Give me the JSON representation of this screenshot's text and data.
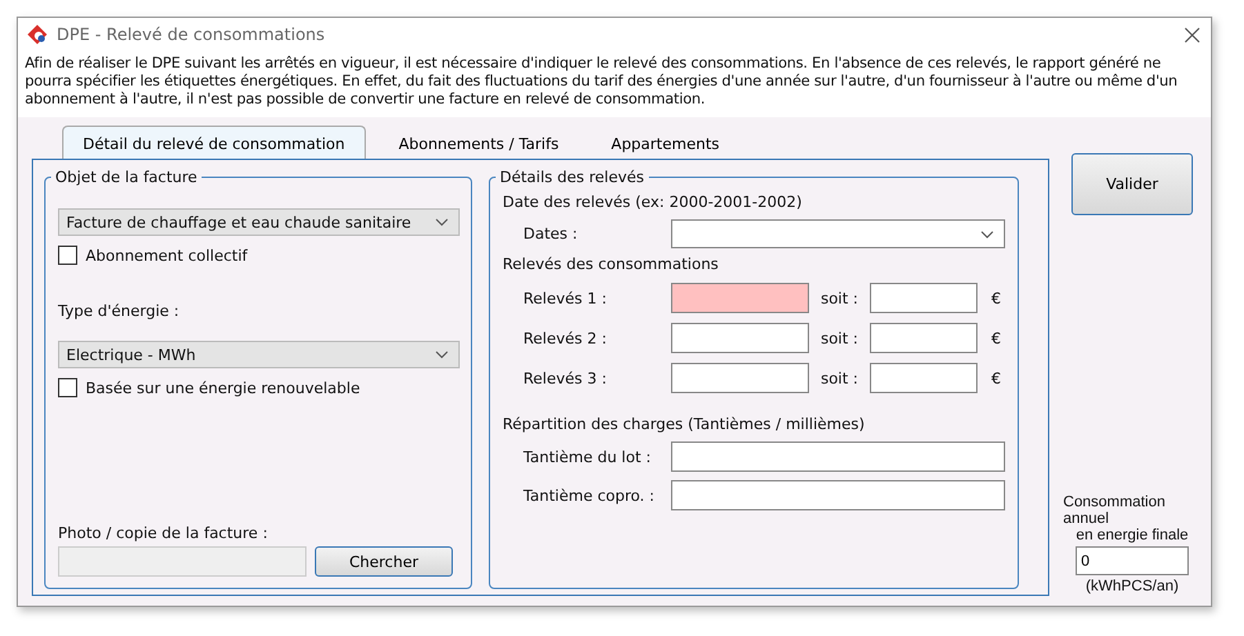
{
  "window": {
    "title": "DPE - Relevé de consommations"
  },
  "intro": "Afin de réaliser le DPE suivant les arrêtés en vigueur, il est nécessaire d'indiquer le relevé des consommations. En l'absence de ces relevés, le rapport généré ne pourra spécifier les étiquettes énergétiques. En effet, du fait des fluctuations du tarif des énergies d'une année sur l'autre, d'un fournisseur à l'autre ou même d'un abonnement à l'autre, il n'est pas possible de convertir une facture en relevé de consommation.",
  "tabs": [
    {
      "label": "Détail du relevé de consommation",
      "selected": true
    },
    {
      "label": "Abonnements / Tarifs",
      "selected": false
    },
    {
      "label": "Appartements",
      "selected": false
    }
  ],
  "invoice": {
    "title": "Objet de la facture",
    "invoice_type": "Facture de chauffage et eau chaude sanitaire",
    "collective": {
      "label": "Abonnement collectif",
      "checked": false
    },
    "energy_label": "Type d'énergie :",
    "energy_type": "Electrique - MWh",
    "renewable": {
      "label": "Basée sur une énergie renouvelable",
      "checked": false
    },
    "photo_label": "Photo / copie de la facture :",
    "browse_button": "Chercher"
  },
  "readings": {
    "title": "Détails des relevés",
    "dates_heading": "Date des relevés (ex: 2000-2001-2002)",
    "dates_label": "Dates :",
    "consumption_heading": "Relevés des consommations",
    "rows": [
      {
        "label": "Relevés 1 :",
        "invalid": true,
        "equals": "soit :",
        "currency": "€"
      },
      {
        "label": "Relevés 2 :",
        "invalid": false,
        "equals": "soit :",
        "currency": "€"
      },
      {
        "label": "Relevés 3 :",
        "invalid": false,
        "equals": "soit :",
        "currency": "€"
      }
    ],
    "charges_heading": "Répartition des charges (Tantièmes / millièmes)",
    "shares": [
      {
        "label": "Tantième du lot :"
      },
      {
        "label": "Tantième copro. :"
      }
    ]
  },
  "validate_button": "Valider",
  "annual": {
    "label_line1": "Consommation annuel",
    "label_line2": "en energie finale",
    "value": "0",
    "unit": "(kWhPCS/an)"
  }
}
